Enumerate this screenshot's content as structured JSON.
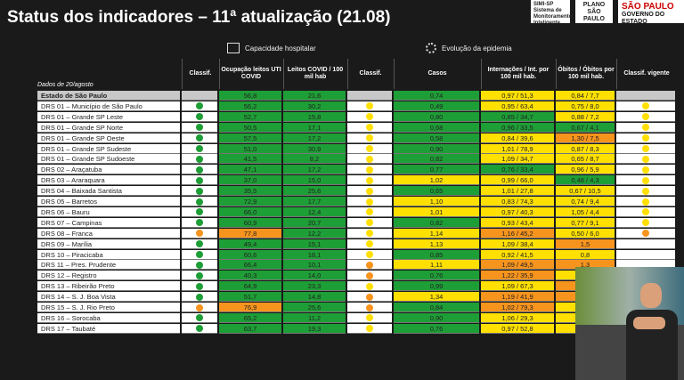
{
  "title": "Status dos indicadores – 11ª atualização (21.08)",
  "logos": {
    "simi": "SIMI-SP Sistema de Monitoramento Inteligente",
    "plano": "PLANO SÃO PAULO",
    "gov_top": "SÃO PAULO",
    "gov_bottom": "GOVERNO DO ESTADO"
  },
  "section_hospital": "Capacidade hospitalar",
  "section_epidemia": "Evolução da epidemia",
  "columns": {
    "date": "Dados de 20/agosto",
    "classif1": "Classif.",
    "ocupacao": "Ocupação leitos UTI COVID",
    "leitos": "Leitos COVID / 100 mil hab",
    "classif2": "Classif.",
    "casos": "Casos",
    "internacoes": "Internações / Int. por 100 mil hab.",
    "obitos": "Óbitos / Óbitos por 100 mil hab.",
    "vigente": "Classif. vigente"
  },
  "colors": {
    "green": "#1e9e36",
    "yellow": "#ffe000",
    "orange": "#f7941d"
  },
  "rows": [
    {
      "name": "Estado de São Paulo",
      "c1": "",
      "ocup": "56,8",
      "ocup_c": "green",
      "leit": "21,6",
      "leit_c": "green",
      "c2": "",
      "casos": "0,74",
      "casos_c": "green",
      "int": "0,97 / 51,3",
      "int_c": "yellow",
      "ob": "0,84 / 7,7",
      "ob_c": "yellow",
      "vig": ""
    },
    {
      "name": "DRS 01 – Município de São Paulo",
      "c1": "green",
      "ocup": "56,2",
      "ocup_c": "green",
      "leit": "30,2",
      "leit_c": "green",
      "c2": "yellow",
      "casos": "0,49",
      "casos_c": "green",
      "int": "0,95 / 63,4",
      "int_c": "yellow",
      "ob": "0,75 / 8,0",
      "ob_c": "yellow",
      "vig": "yellow"
    },
    {
      "name": "DRS 01 – Grande SP Leste",
      "c1": "green",
      "ocup": "52,7",
      "ocup_c": "green",
      "leit": "15,8",
      "leit_c": "green",
      "c2": "yellow",
      "casos": "0,80",
      "casos_c": "green",
      "int": "0,85 / 34,7",
      "int_c": "green",
      "ob": "0,88 / 7,2",
      "ob_c": "yellow",
      "vig": "yellow"
    },
    {
      "name": "DRS 01 – Grande SP Norte",
      "c1": "green",
      "ocup": "50,5",
      "ocup_c": "green",
      "leit": "17,1",
      "leit_c": "green",
      "c2": "yellow",
      "casos": "0,68",
      "casos_c": "green",
      "int": "0,96 / 33,5",
      "int_c": "green",
      "ob": "0,67 / 4,1",
      "ob_c": "green",
      "vig": "yellow"
    },
    {
      "name": "DRS 01 – Grande SP Oeste",
      "c1": "green",
      "ocup": "57,5",
      "ocup_c": "green",
      "leit": "17,2",
      "leit_c": "green",
      "c2": "yellow",
      "casos": "0,58",
      "casos_c": "green",
      "int": "0,84 / 39,6",
      "int_c": "yellow",
      "ob": "1,30 / 7,5",
      "ob_c": "orange",
      "vig": "yellow"
    },
    {
      "name": "DRS 01 – Grande SP Sudeste",
      "c1": "green",
      "ocup": "51,0",
      "ocup_c": "green",
      "leit": "30,9",
      "leit_c": "green",
      "c2": "yellow",
      "casos": "0,90",
      "casos_c": "green",
      "int": "1,01 / 78,9",
      "int_c": "yellow",
      "ob": "0,87 / 8,3",
      "ob_c": "yellow",
      "vig": "yellow"
    },
    {
      "name": "DRS 01 – Grande SP Sudoeste",
      "c1": "green",
      "ocup": "41,5",
      "ocup_c": "green",
      "leit": "8,2",
      "leit_c": "green",
      "c2": "yellow",
      "casos": "0,82",
      "casos_c": "green",
      "int": "1,09 / 34,7",
      "int_c": "yellow",
      "ob": "0,65 / 8,7",
      "ob_c": "yellow",
      "vig": "yellow"
    },
    {
      "name": "DRS 02 – Araçatuba",
      "c1": "green",
      "ocup": "47,1",
      "ocup_c": "green",
      "leit": "17,2",
      "leit_c": "green",
      "c2": "yellow",
      "casos": "0,77",
      "casos_c": "green",
      "int": "0,76 / 33,4",
      "int_c": "green",
      "ob": "0,96 / 5,9",
      "ob_c": "yellow",
      "vig": "yellow"
    },
    {
      "name": "DRS 03 – Araraquara",
      "c1": "green",
      "ocup": "37,0",
      "ocup_c": "green",
      "leit": "15,0",
      "leit_c": "green",
      "c2": "yellow",
      "casos": "1,02",
      "casos_c": "yellow",
      "int": "0,99 / 66,0",
      "int_c": "yellow",
      "ob": "0,48 / 4,3",
      "ob_c": "green",
      "vig": "yellow"
    },
    {
      "name": "DRS 04 – Baixada Santista",
      "c1": "green",
      "ocup": "35,5",
      "ocup_c": "green",
      "leit": "25,6",
      "leit_c": "green",
      "c2": "yellow",
      "casos": "0,65",
      "casos_c": "green",
      "int": "1,01 / 27,8",
      "int_c": "yellow",
      "ob": "0,67 / 10,5",
      "ob_c": "yellow",
      "vig": "yellow"
    },
    {
      "name": "DRS 05 – Barretos",
      "c1": "green",
      "ocup": "72,9",
      "ocup_c": "green",
      "leit": "17,7",
      "leit_c": "green",
      "c2": "yellow",
      "casos": "1,10",
      "casos_c": "yellow",
      "int": "0,83 / 74,3",
      "int_c": "yellow",
      "ob": "0,74 / 9,4",
      "ob_c": "yellow",
      "vig": "yellow"
    },
    {
      "name": "DRS 06 – Bauru",
      "c1": "green",
      "ocup": "66,0",
      "ocup_c": "green",
      "leit": "12,4",
      "leit_c": "green",
      "c2": "yellow",
      "casos": "1,01",
      "casos_c": "yellow",
      "int": "0,97 / 40,3",
      "int_c": "yellow",
      "ob": "1,05 / 4,4",
      "ob_c": "yellow",
      "vig": "yellow"
    },
    {
      "name": "DRS 07 – Campinas",
      "c1": "green",
      "ocup": "60,9",
      "ocup_c": "green",
      "leit": "20,7",
      "leit_c": "green",
      "c2": "yellow",
      "casos": "0,82",
      "casos_c": "green",
      "int": "0,93 / 43,4",
      "int_c": "yellow",
      "ob": "0,77 / 9,1",
      "ob_c": "yellow",
      "vig": "yellow"
    },
    {
      "name": "DRS 08 – Franca",
      "c1": "orange",
      "ocup": "77,8",
      "ocup_c": "orange",
      "leit": "12,2",
      "leit_c": "green",
      "c2": "yellow",
      "casos": "1,14",
      "casos_c": "yellow",
      "int": "1,16 / 45,2",
      "int_c": "orange",
      "ob": "0,50 / 6,0",
      "ob_c": "yellow",
      "vig": "orange"
    },
    {
      "name": "DRS 09 – Marília",
      "c1": "green",
      "ocup": "49,4",
      "ocup_c": "green",
      "leit": "15,1",
      "leit_c": "green",
      "c2": "yellow",
      "casos": "1,13",
      "casos_c": "yellow",
      "int": "1,09 / 38,4",
      "int_c": "yellow",
      "ob": "1,5",
      "ob_c": "orange",
      "vig": ""
    },
    {
      "name": "DRS 10 – Piracicaba",
      "c1": "green",
      "ocup": "60,6",
      "ocup_c": "green",
      "leit": "18,1",
      "leit_c": "green",
      "c2": "yellow",
      "casos": "0,85",
      "casos_c": "green",
      "int": "0,92 / 41,5",
      "int_c": "yellow",
      "ob": "0,8",
      "ob_c": "yellow",
      "vig": ""
    },
    {
      "name": "DRS 11 – Pres. Prudente",
      "c1": "green",
      "ocup": "66,4",
      "ocup_c": "green",
      "leit": "10,1",
      "leit_c": "green",
      "c2": "orange",
      "casos": "1,11",
      "casos_c": "yellow",
      "int": "1,09 / 49,5",
      "int_c": "orange",
      "ob": "1,3",
      "ob_c": "orange",
      "vig": ""
    },
    {
      "name": "DRS 12 – Registro",
      "c1": "green",
      "ocup": "40,3",
      "ocup_c": "green",
      "leit": "14,0",
      "leit_c": "green",
      "c2": "orange",
      "casos": "0,76",
      "casos_c": "green",
      "int": "1,22 / 35,9",
      "int_c": "orange",
      "ob": "0,61",
      "ob_c": "yellow",
      "vig": ""
    },
    {
      "name": "DRS 13 – Ribeirão Preto",
      "c1": "green",
      "ocup": "64,9",
      "ocup_c": "green",
      "leit": "23,3",
      "leit_c": "green",
      "c2": "yellow",
      "casos": "0,99",
      "casos_c": "green",
      "int": "1,09 / 67,3",
      "int_c": "yellow",
      "ob": "1,22",
      "ob_c": "orange",
      "vig": ""
    },
    {
      "name": "DRS 14 – S. J. Boa Vista",
      "c1": "green",
      "ocup": "51,7",
      "ocup_c": "green",
      "leit": "14,8",
      "leit_c": "green",
      "c2": "orange",
      "casos": "1,34",
      "casos_c": "yellow",
      "int": "1,19 / 41,9",
      "int_c": "orange",
      "ob": "1,2",
      "ob_c": "orange",
      "vig": ""
    },
    {
      "name": "DRS 15 – S. J. Rio Preto",
      "c1": "orange",
      "ocup": "76,9",
      "ocup_c": "orange",
      "leit": "25,6",
      "leit_c": "green",
      "c2": "orange",
      "casos": "0,84",
      "casos_c": "green",
      "int": "1,02 / 79,3",
      "int_c": "orange",
      "ob": "0,98",
      "ob_c": "yellow",
      "vig": ""
    },
    {
      "name": "DRS 16 – Sorocaba",
      "c1": "green",
      "ocup": "65,2",
      "ocup_c": "green",
      "leit": "11,2",
      "leit_c": "green",
      "c2": "yellow",
      "casos": "0,90",
      "casos_c": "green",
      "int": "1,06 / 29,3",
      "int_c": "yellow",
      "ob": "0,9",
      "ob_c": "yellow",
      "vig": ""
    },
    {
      "name": "DRS 17 – Taubaté",
      "c1": "green",
      "ocup": "63,7",
      "ocup_c": "green",
      "leit": "19,3",
      "leit_c": "green",
      "c2": "yellow",
      "casos": "0,76",
      "casos_c": "green",
      "int": "0,97 / 52,8",
      "int_c": "yellow",
      "ob": "0,9",
      "ob_c": "yellow",
      "vig": ""
    }
  ]
}
